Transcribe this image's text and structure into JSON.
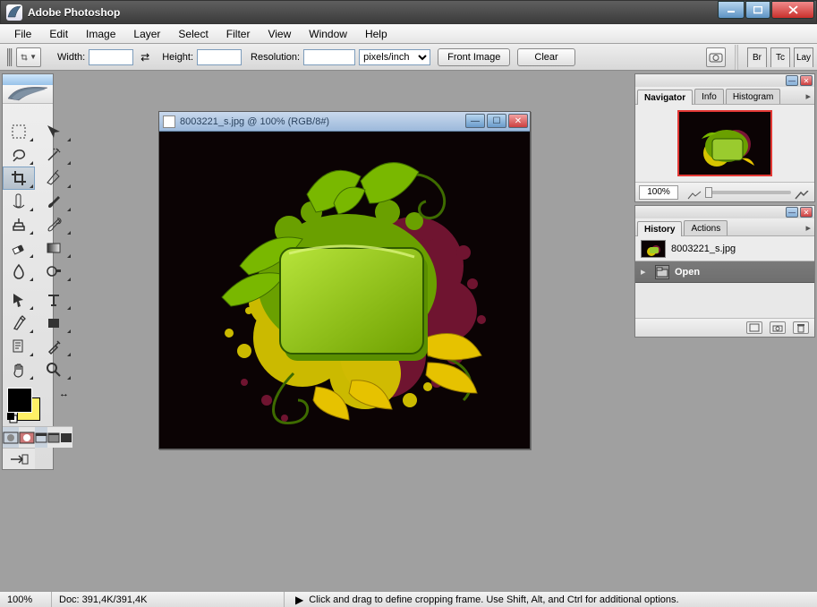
{
  "titlebar": {
    "title": "Adobe Photoshop"
  },
  "menu": {
    "items": [
      "File",
      "Edit",
      "Image",
      "Layer",
      "Select",
      "Filter",
      "View",
      "Window",
      "Help"
    ]
  },
  "options": {
    "width_label": "Width:",
    "width_value": "",
    "height_label": "Height:",
    "height_value": "",
    "resolution_label": "Resolution:",
    "resolution_value": "",
    "units": "pixels/inch",
    "front_image": "Front Image",
    "clear": "Clear",
    "panel_tabs": [
      "Br",
      "Tc",
      "Lay"
    ]
  },
  "toolbox": {
    "tools": [
      [
        "rectangular-marquee",
        "move"
      ],
      [
        "lasso",
        "magic-wand"
      ],
      [
        "crop",
        "slice"
      ],
      [
        "healing-brush",
        "brush"
      ],
      [
        "clone-stamp",
        "history-brush"
      ],
      [
        "eraser",
        "gradient"
      ],
      [
        "blur",
        "dodge"
      ],
      [
        "path-selection",
        "type"
      ],
      [
        "pen",
        "shape"
      ],
      [
        "notes",
        "eyedropper"
      ],
      [
        "hand",
        "zoom"
      ]
    ],
    "active_tool": "crop",
    "fg_color": "#000000",
    "bg_color": "#fff066"
  },
  "document": {
    "title": "8003221_s.jpg @ 100% (RGB/8#)"
  },
  "navigator": {
    "tabs": [
      "Navigator",
      "Info",
      "Histogram"
    ],
    "active_tab": 0,
    "zoom": "100%"
  },
  "history": {
    "tabs": [
      "History",
      "Actions"
    ],
    "active_tab": 0,
    "source_label": "8003221_s.jpg",
    "items": [
      {
        "name": "Open"
      }
    ]
  },
  "statusbar": {
    "zoom": "100%",
    "doc_info": "Doc: 391,4K/391,4K",
    "hint": "Click and drag to define cropping frame. Use Shift, Alt, and Ctrl for additional options."
  }
}
